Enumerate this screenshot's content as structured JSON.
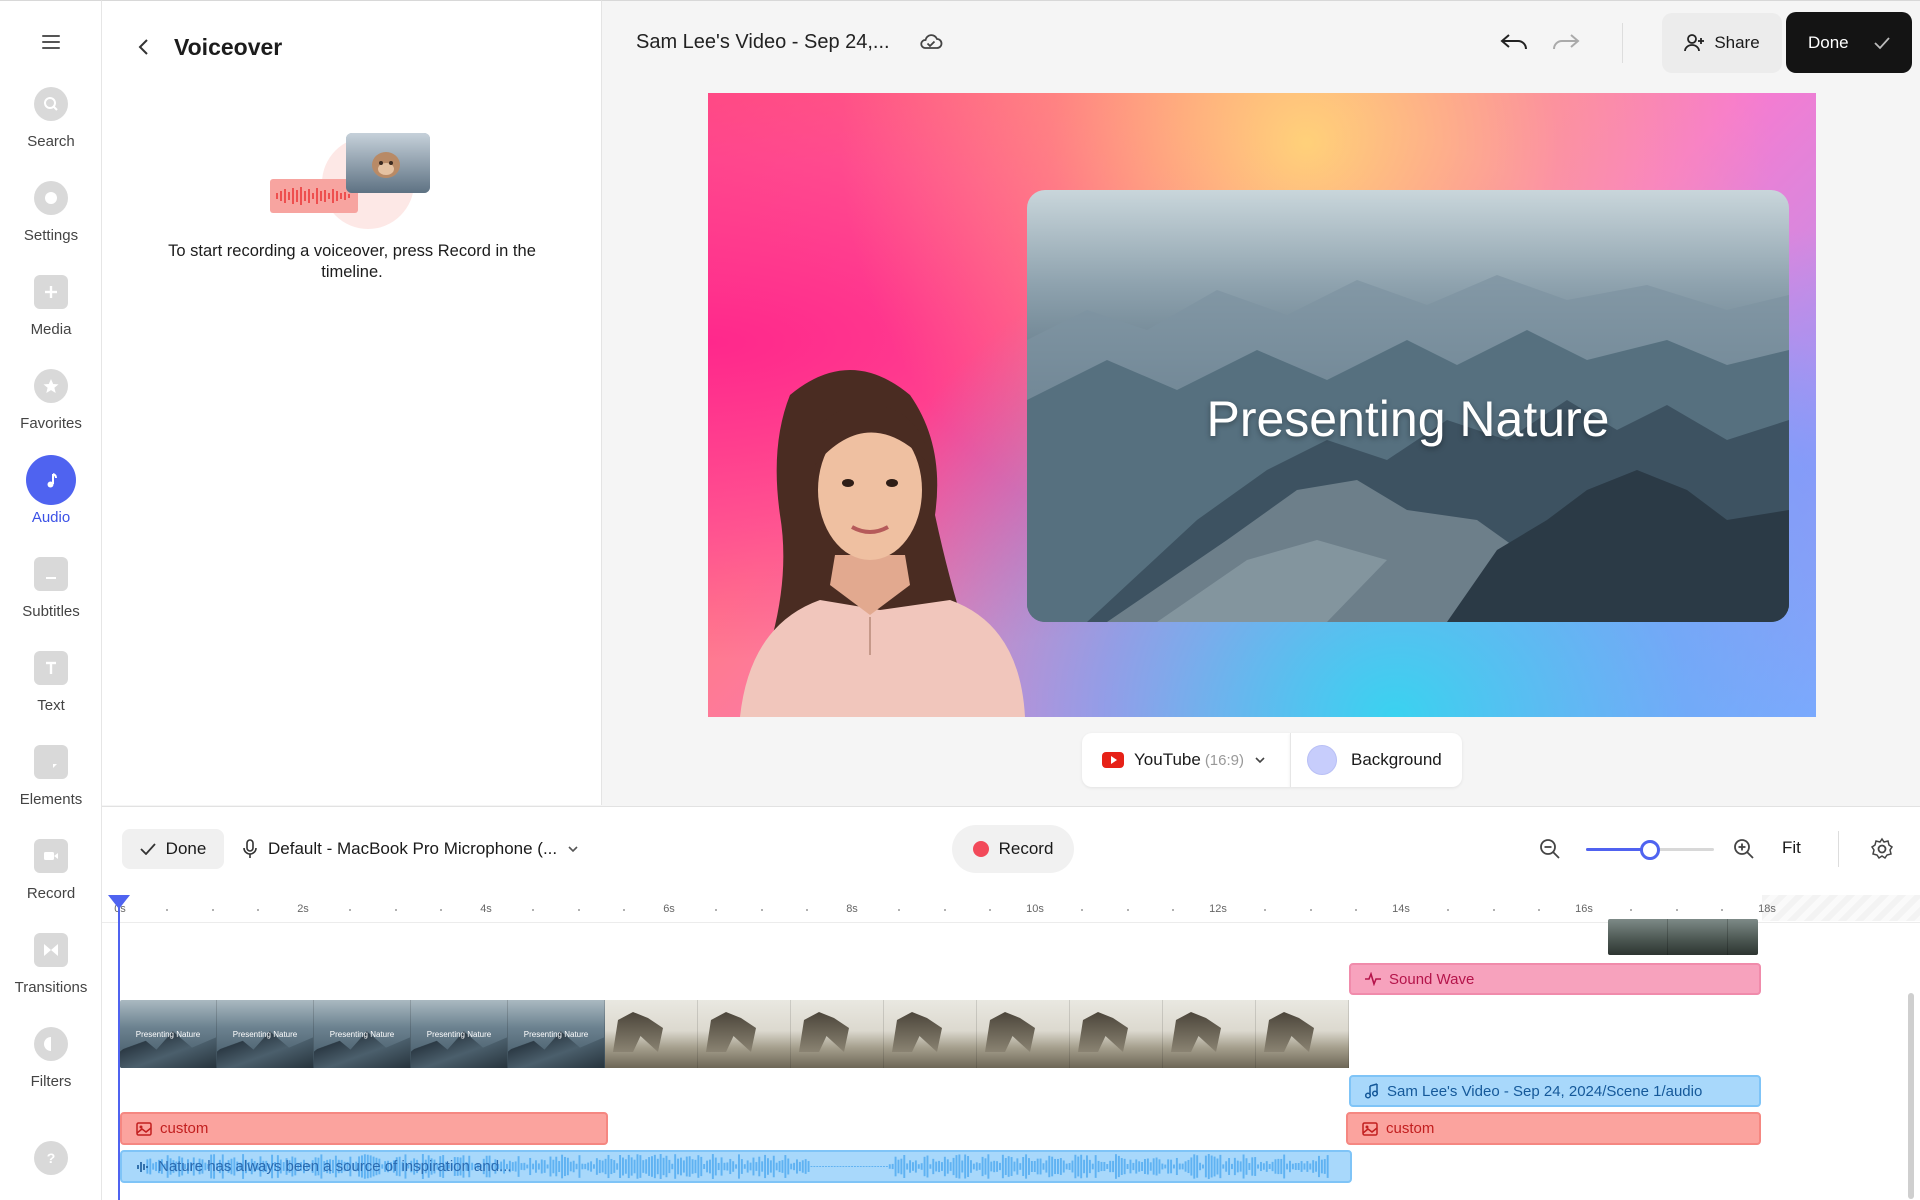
{
  "rail": {
    "items": [
      {
        "label": "Search",
        "icon": "search-icon"
      },
      {
        "label": "Settings",
        "icon": "settings-icon"
      },
      {
        "label": "Media",
        "icon": "plus-icon"
      },
      {
        "label": "Favorites",
        "icon": "star-icon"
      },
      {
        "label": "Audio",
        "icon": "music-note-icon",
        "active": true
      },
      {
        "label": "Subtitles",
        "icon": "subtitles-icon"
      },
      {
        "label": "Text",
        "icon": "text-icon"
      },
      {
        "label": "Elements",
        "icon": "elements-icon"
      },
      {
        "label": "Record",
        "icon": "camera-icon"
      },
      {
        "label": "Transitions",
        "icon": "transitions-icon"
      },
      {
        "label": "Filters",
        "icon": "filters-icon"
      }
    ],
    "help_icon": "help-icon"
  },
  "panel": {
    "title": "Voiceover",
    "hint": "To start recording a voiceover, press Record in the timeline."
  },
  "header": {
    "project_title": "Sam Lee's Video - Sep 24,...",
    "share_label": "Share",
    "done_label": "Done"
  },
  "canvas": {
    "headline": "Presenting Nature",
    "aspect_platform": "YouTube",
    "aspect_ratio": "(16:9)",
    "background_label": "Background",
    "background_color": "#c7cdfc"
  },
  "timeline": {
    "done_label": "Done",
    "microphone": "Default - MacBook Pro Microphone (...",
    "record_label": "Record",
    "fit_label": "Fit",
    "zoom_level": 0.5,
    "ruler": [
      "0s",
      "2s",
      "4s",
      "6s",
      "8s",
      "10s",
      "12s",
      "14s",
      "16s",
      "18s"
    ],
    "clips": {
      "sound_wave": "Sound Wave",
      "scene_audio": "Sam Lee's Video - Sep 24, 2024/Scene 1/audio",
      "custom_1": "custom",
      "custom_2": "custom",
      "narration": "Nature has always been a source of inspiration and...",
      "thumb_caption": "Presenting Nature"
    },
    "colors": {
      "accent": "#4f63f0",
      "image_clip": "#fba39e",
      "effect_clip": "#f7a2bd",
      "audio_clip": "#a8d8fb",
      "record_dot": "#f24a5a"
    }
  }
}
